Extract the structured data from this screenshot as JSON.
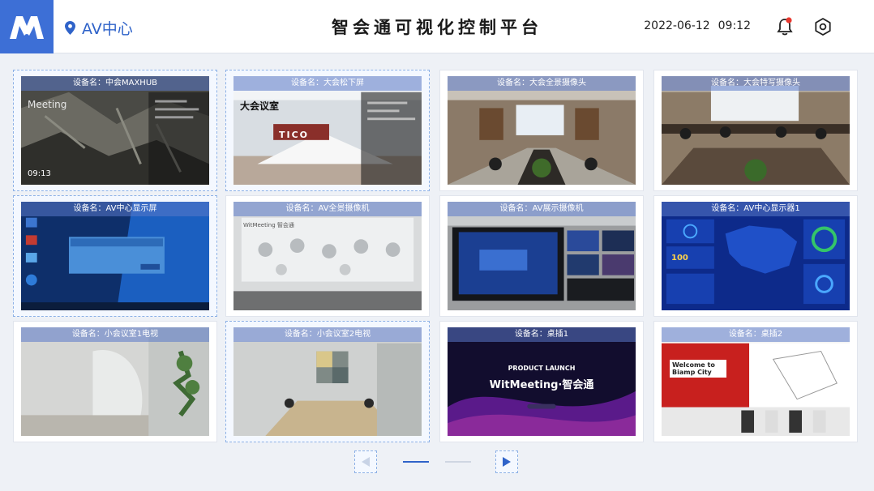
{
  "header": {
    "location": "AV中心",
    "title": "智会通可视化控制平台",
    "date": "2022-06-12",
    "time": "09:12"
  },
  "devices": [
    {
      "caption": "设备名：中会MAXHUB",
      "overlay": "Meeting",
      "overlay2": "09:13",
      "selected": true
    },
    {
      "caption": "设备名：大会松下屏",
      "overlay": "大会议室",
      "overlay2": "TICO",
      "selected": true
    },
    {
      "caption": "设备名：大会全景摄像头",
      "overlay": "",
      "overlay2": "",
      "selected": false
    },
    {
      "caption": "设备名：大会特写摄像头",
      "overlay": "",
      "overlay2": "",
      "selected": false
    },
    {
      "caption": "设备名：AV中心显示屏",
      "overlay": "",
      "overlay2": "",
      "selected": true
    },
    {
      "caption": "设备名：AV全景摄像机",
      "overlay": "WitMeeting 智会通",
      "overlay2": "",
      "selected": false
    },
    {
      "caption": "设备名：AV展示摄像机",
      "overlay": "",
      "overlay2": "",
      "selected": false
    },
    {
      "caption": "设备名：AV中心显示器1",
      "overlay": "100",
      "overlay2": "",
      "selected": false
    },
    {
      "caption": "设备名：小会议室1电视",
      "overlay": "",
      "overlay2": "",
      "selected": false
    },
    {
      "caption": "设备名：小会议室2电视",
      "overlay": "",
      "overlay2": "",
      "selected": true
    },
    {
      "caption": "设备名：桌插1",
      "overlay": "WitMeeting·智会通",
      "overlay2": "PRODUCT LAUNCH",
      "selected": false
    },
    {
      "caption": "设备名：桌插2",
      "overlay": "Welcome to Biamp City",
      "overlay2": "",
      "selected": false
    }
  ],
  "pager": {
    "current_page": 1,
    "total_pages": 2
  },
  "colors": {
    "accent": "#3d6fd6",
    "caption_bg": "#5a78c8",
    "card_bg": "#ffffff",
    "page_bg": "#eef1f6"
  },
  "icons": {
    "logo": "logo-icon",
    "location": "location-pin-icon",
    "bell": "bell-icon",
    "settings": "gear-icon",
    "prev": "triangle-left-icon",
    "next": "triangle-right-icon"
  }
}
